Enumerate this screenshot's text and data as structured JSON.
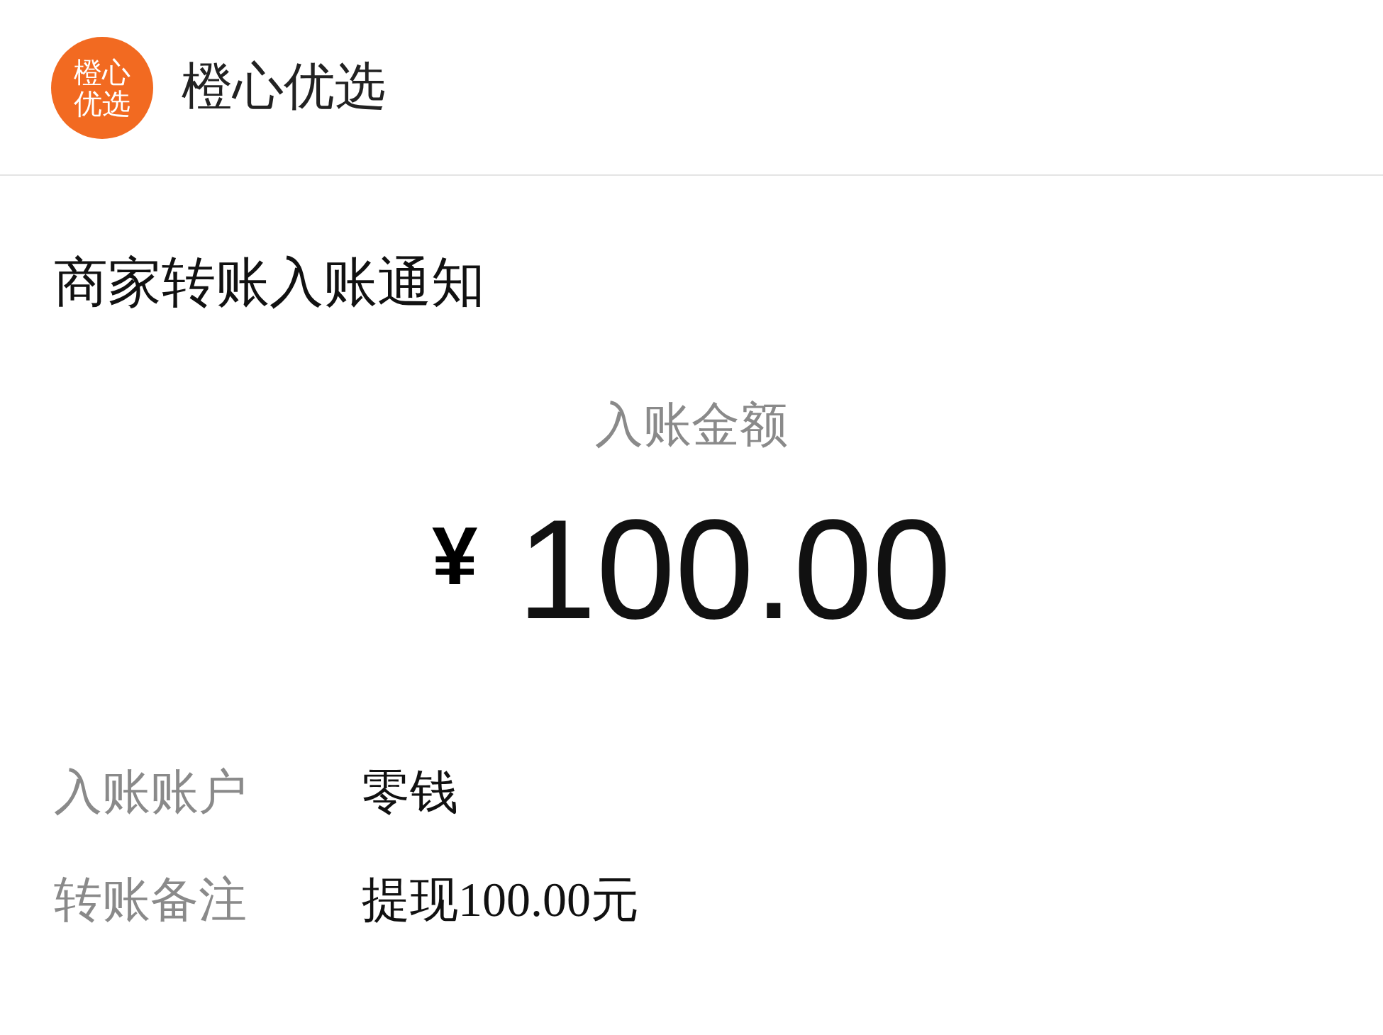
{
  "header": {
    "logo_text": "橙心优选",
    "title": "橙心优选"
  },
  "notice": {
    "title": "商家转账入账通知",
    "amount_label": "入账金额",
    "currency": "¥",
    "amount": "100.00",
    "details": [
      {
        "label": "入账账户",
        "value": "零钱"
      },
      {
        "label": "转账备注",
        "value": "提现100.00元"
      }
    ]
  }
}
